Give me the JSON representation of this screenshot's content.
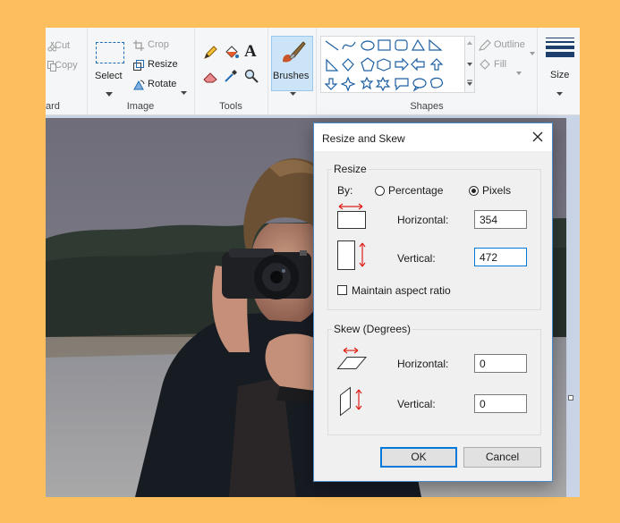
{
  "ribbon": {
    "clipboard": {
      "cut_label": "Cut",
      "copy_label": "Copy",
      "group_label": "ard"
    },
    "image": {
      "select_label": "Select",
      "crop_label": "Crop",
      "resize_label": "Resize",
      "rotate_label": "Rotate",
      "group_label": "Image"
    },
    "tools": {
      "group_label": "Tools"
    },
    "brushes": {
      "label": "Brushes"
    },
    "shapes": {
      "outline_label": "Outline",
      "fill_label": "Fill",
      "group_label": "Shapes"
    },
    "size": {
      "label": "Size"
    }
  },
  "dialog": {
    "title": "Resize and Skew",
    "resize": {
      "section_label": "Resize",
      "by_label": "By:",
      "percentage_label": "Percentage",
      "pixels_label": "Pixels",
      "selected": "Pixels",
      "horizontal_label": "Horizontal:",
      "horizontal_value": "354",
      "vertical_label": "Vertical:",
      "vertical_value": "472",
      "aspect_label": "Maintain aspect ratio",
      "aspect_checked": false
    },
    "skew": {
      "section_label": "Skew (Degrees)",
      "horizontal_label": "Horizontal:",
      "horizontal_value": "0",
      "vertical_label": "Vertical:",
      "vertical_value": "0"
    },
    "ok_label": "OK",
    "cancel_label": "Cancel"
  },
  "colors": {
    "background": "#fdbf5d",
    "accent": "#0078d7",
    "arrow": "#e0201b"
  }
}
